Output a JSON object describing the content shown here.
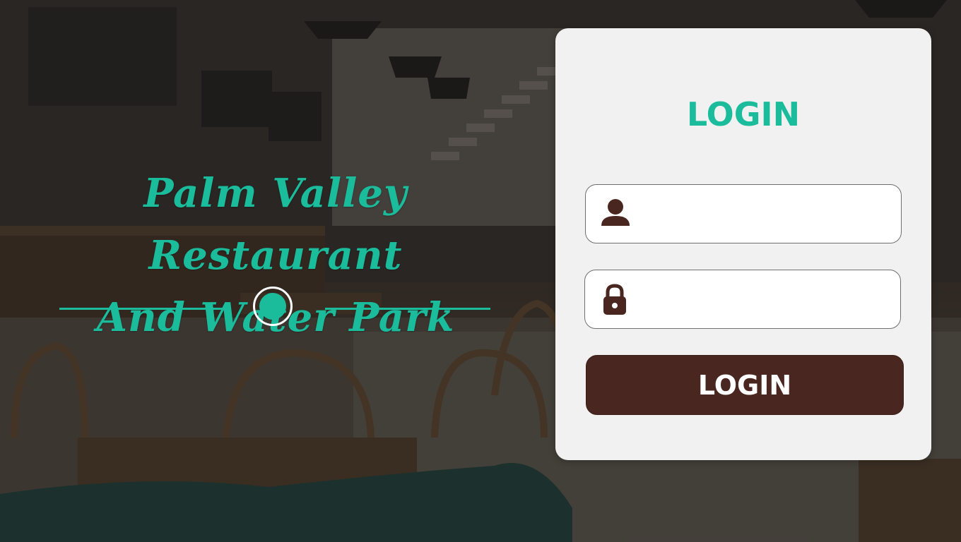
{
  "brand": {
    "line1": "Palm Valley Restaurant",
    "line2": "And Water Park",
    "accent_color": "#1abc9c"
  },
  "login": {
    "heading": "LOGIN",
    "username_icon": "user-icon",
    "password_icon": "lock-icon",
    "username_value": "",
    "password_value": "",
    "button_label": "LOGIN",
    "button_color": "#4a2620"
  }
}
